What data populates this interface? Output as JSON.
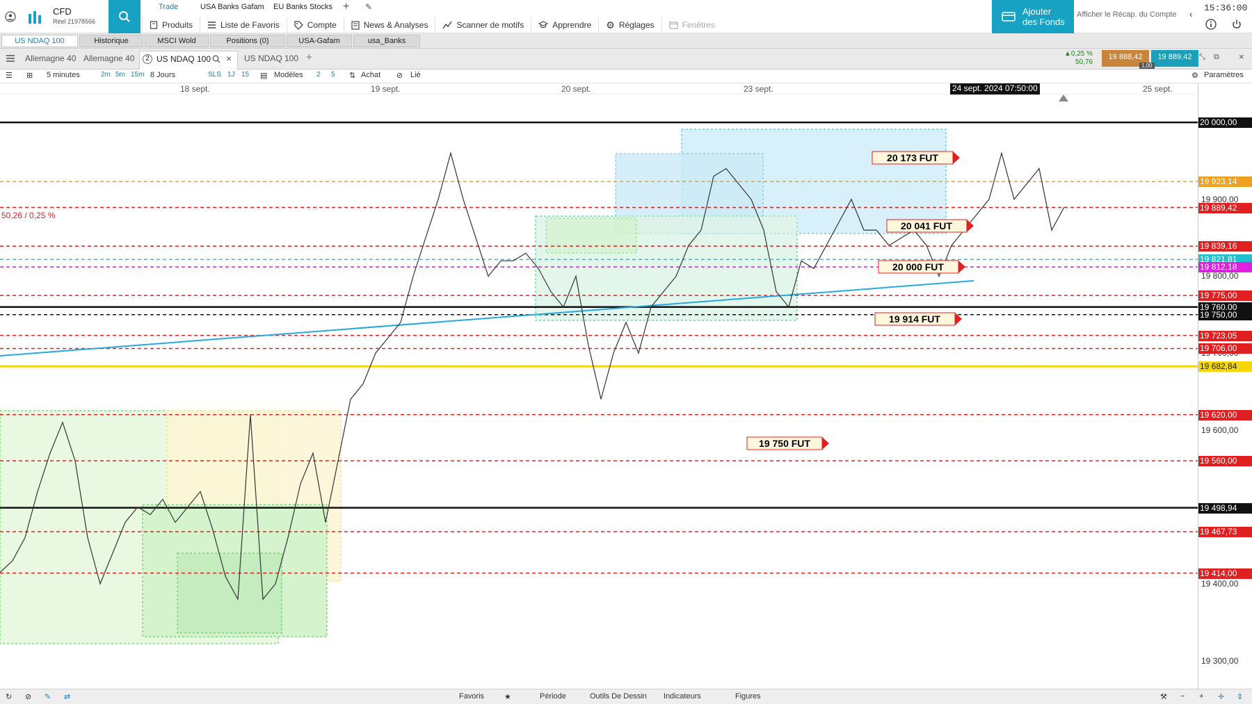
{
  "header": {
    "account_title": "CFD",
    "account_sub": "Réel 21978566",
    "watchlist_tabs": [
      "Trade",
      "USA Banks Gafam",
      "EU Banks Stocks"
    ],
    "menu": [
      {
        "label": "Produits",
        "icon": "products-icon"
      },
      {
        "label": "Liste de Favoris",
        "icon": "list-icon"
      },
      {
        "label": "Compte",
        "icon": "tag-icon"
      },
      {
        "label": "News & Analyses",
        "icon": "news-icon"
      },
      {
        "label": "Scanner de motifs",
        "icon": "pattern-icon"
      },
      {
        "label": "Apprendre",
        "icon": "learn-icon"
      },
      {
        "label": "Réglages",
        "icon": "gear-icon"
      },
      {
        "label": "Fenêtres",
        "icon": "windows-icon"
      }
    ],
    "funds_button_line1": "Ajouter",
    "funds_button_line2": "des Fonds",
    "recap_link": "Afficher le Récap. du Compte",
    "time": "15:36:00"
  },
  "instrument_tabs": [
    "US NDAQ 100",
    "Historique",
    "MSCI Wold",
    "Positions (0)",
    "USA-Gafam",
    "usa_Banks"
  ],
  "chart_tabs": {
    "tab1": "Allemagne 40",
    "tab2": "Allemagne 40",
    "active_number": "2",
    "active": "US NDAQ 100",
    "tab4": "US NDAQ 100"
  },
  "quote": {
    "change_pct": "▲0,25 %",
    "change_abs": "50,76",
    "bid": "19 888,42",
    "ask": "19 889,42",
    "spread": "1,00"
  },
  "toolbar": {
    "interval": "5 minutes",
    "quick_intervals": [
      "2m",
      "5m",
      "15m"
    ],
    "range": "8 Jours",
    "range_buttons": [
      "SLS",
      "1J",
      "15"
    ],
    "models": "Modèles",
    "model_buttons": [
      "2",
      "5"
    ],
    "buy": "Achat",
    "linked": "Lié",
    "settings": "Paramètres"
  },
  "chart_data": {
    "type": "line",
    "instrument": "US NDAQ 100",
    "x_labels": [
      "18 sept.",
      "19 sept.",
      "20 sept.",
      "23 sept.",
      "25 sept."
    ],
    "crosshair_date": "24 sept. 2024 07:50:00",
    "ylim": [
      19270,
      20020
    ],
    "y_ticks": [
      "20 000,00",
      "19 900,00",
      "19 800,00",
      "19 700,00",
      "19 600,00",
      "19 400,00",
      "19 300,00"
    ],
    "level_badges": [
      {
        "label": "20 000,00",
        "value": 20000.0,
        "color": "#111111"
      },
      {
        "label": "19 923,14",
        "value": 19923.14,
        "color": "#f0a020"
      },
      {
        "label": "19 889,42",
        "value": 19889.42,
        "color": "#e02020"
      },
      {
        "label": "19 839,16",
        "value": 19839.16,
        "color": "#e02020"
      },
      {
        "label": "19 821,81",
        "value": 19821.81,
        "color": "#20c0d0"
      },
      {
        "label": "19 812,18",
        "value": 19812.18,
        "color": "#e020e0"
      },
      {
        "label": "19 775,00",
        "value": 19775.0,
        "color": "#e02020"
      },
      {
        "label": "19 760,00",
        "value": 19760.0,
        "color": "#111111"
      },
      {
        "label": "19 750,00",
        "value": 19750.0,
        "color": "#111111"
      },
      {
        "label": "19 723,05",
        "value": 19723.05,
        "color": "#e02020"
      },
      {
        "label": "19 706,00",
        "value": 19706.0,
        "color": "#e02020"
      },
      {
        "label": "19 682,84",
        "value": 19682.84,
        "color": "#f5d800"
      },
      {
        "label": "19 620,00",
        "value": 19620.0,
        "color": "#e02020"
      },
      {
        "label": "19 560,00",
        "value": 19560.0,
        "color": "#e02020"
      },
      {
        "label": "19 498,94",
        "value": 19498.94,
        "color": "#111111"
      },
      {
        "label": "19 467,73",
        "value": 19467.73,
        "color": "#e02020"
      },
      {
        "label": "19 414,00",
        "value": 19414.0,
        "color": "#e02020"
      }
    ],
    "annotations": [
      "20 173 FUT",
      "20 041 FUT",
      "20 000 FUT",
      "19 914  FUT",
      "19 750 FUT"
    ],
    "change_label": "50,26 / 0,25 %",
    "price_series": [
      19415,
      19430,
      19460,
      19520,
      19570,
      19610,
      19560,
      19460,
      19400,
      19440,
      19480,
      19500,
      19490,
      19510,
      19480,
      19500,
      19520,
      19470,
      19410,
      19380,
      19620,
      19380,
      19400,
      19460,
      19530,
      19570,
      19480,
      19560,
      19640,
      19660,
      19700,
      19720,
      19740,
      19800,
      19850,
      19900,
      19960,
      19900,
      19850,
      19800,
      19820,
      19820,
      19830,
      19810,
      19780,
      19760,
      19800,
      19710,
      19640,
      19700,
      19740,
      19700,
      19760,
      19780,
      19800,
      19840,
      19860,
      19930,
      19940,
      19920,
      19900,
      19860,
      19780,
      19760,
      19820,
      19810,
      19840,
      19870,
      19900,
      19860,
      19860,
      19840,
      19850,
      19860,
      19840,
      19800,
      19840,
      19860,
      19880,
      19900,
      19960,
      19900,
      19920,
      19940,
      19860,
      19890
    ]
  },
  "bottombar": {
    "items": [
      "Favoris",
      "Période",
      "Outils De Dessin",
      "Indicateurs",
      "Figures"
    ]
  }
}
